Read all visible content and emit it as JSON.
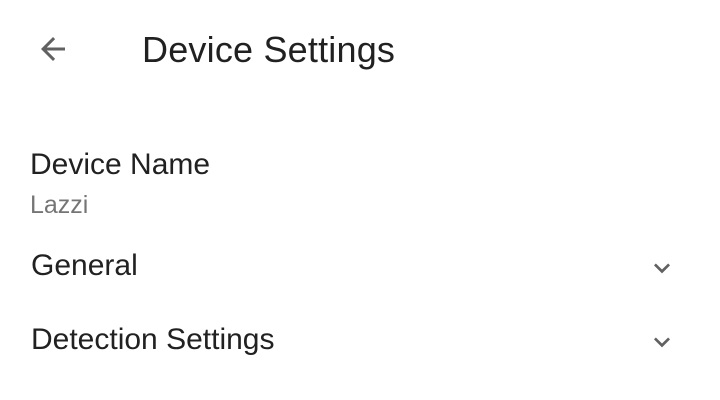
{
  "header": {
    "back_icon": "arrow-left-icon",
    "title": "Device Settings"
  },
  "device_name": {
    "label": "Device Name",
    "value": "Lazzi"
  },
  "sections": [
    {
      "label": "General",
      "icon": "chevron-down-icon",
      "expanded": false
    },
    {
      "label": "Detection Settings",
      "icon": "chevron-down-icon",
      "expanded": false
    }
  ],
  "colors": {
    "background": "#ffffff",
    "primary_text": "#212121",
    "secondary_text": "#757575",
    "icon": "#616161"
  }
}
